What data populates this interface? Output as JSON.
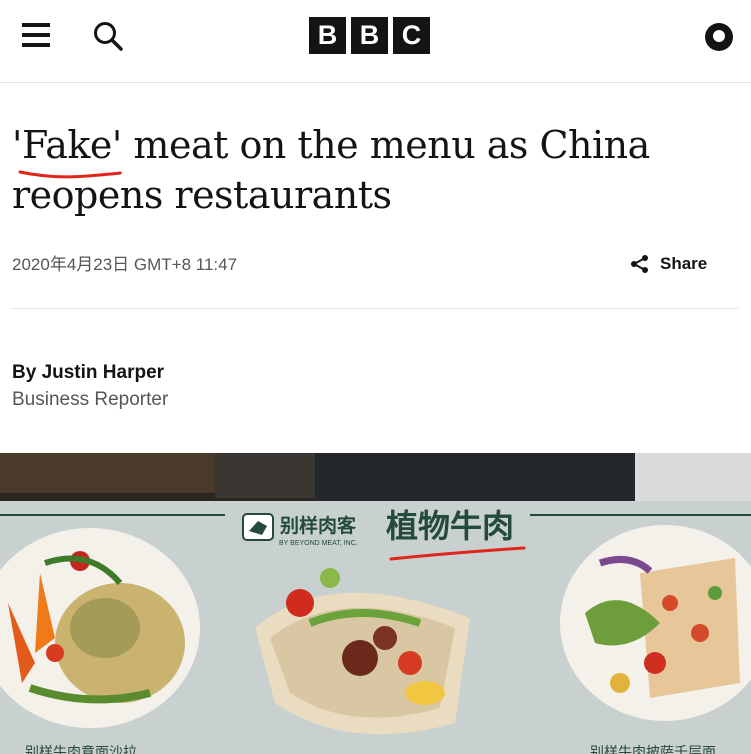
{
  "header": {
    "menu_icon": "hamburger-menu-icon",
    "search_icon": "search-icon",
    "logo_letters": [
      "B",
      "B",
      "C"
    ],
    "account_icon": "account-icon"
  },
  "article": {
    "headline": "'Fake' meat on the menu as China reopens restaurants",
    "timestamp": "2020年4月23日 GMT+8 11:47",
    "share_label": "Share",
    "author": "By Justin Harper",
    "author_role": "Business Reporter"
  },
  "image": {
    "brand_cn": "别样肉客",
    "brand_en": "BY BEYOND MEAT, INC.",
    "product_cn": "植物牛肉",
    "bottom_left_text": "别样牛肉意面沙拉",
    "bottom_right_text": "别样牛肉披萨千层面"
  },
  "colors": {
    "annotation": "#e1251b",
    "text_primary": "#141414",
    "text_secondary": "#545658",
    "menu_card": "#c7d0ce",
    "menu_green": "#234a3a"
  }
}
